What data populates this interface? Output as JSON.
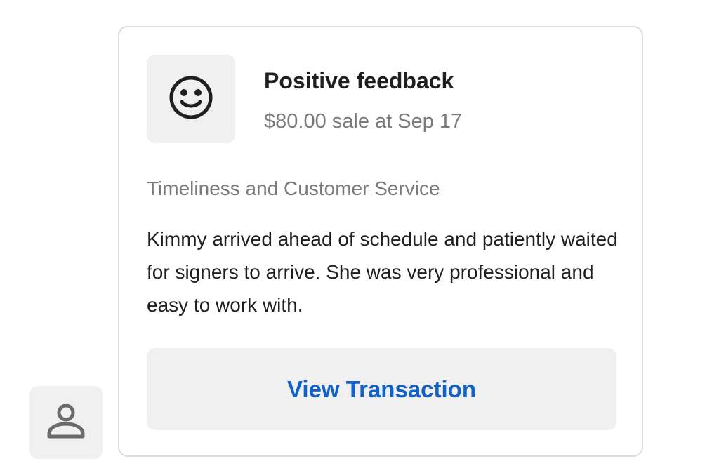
{
  "avatar": {
    "icon": "person-icon"
  },
  "card": {
    "icon": "smiley-face-icon",
    "title": "Positive feedback",
    "subtitle": "$80.00 sale at Sep 17",
    "category": "Timeliness and Customer Service",
    "body": "Kimmy arrived ahead of schedule and patiently waited for signers to arrive. She was very professional and easy to work with.",
    "button_label": "View Transaction"
  },
  "colors": {
    "accent": "#1260c9",
    "icon_bg": "#f0f0f0",
    "border": "#dcdcdc",
    "muted_text": "#7a7a7a"
  }
}
